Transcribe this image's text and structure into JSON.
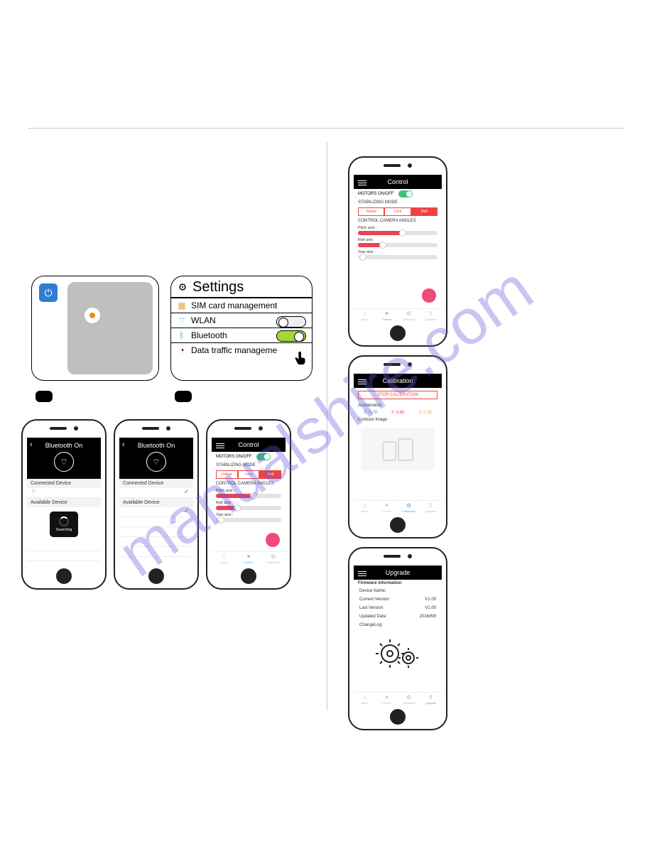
{
  "watermark": "manualshire.com",
  "settings_panel": {
    "title": "Settings",
    "rows": {
      "sim": "SIM card management",
      "wlan": "WLAN",
      "bluetooth": "Bluetooth",
      "data": "Data traffic manageme"
    }
  },
  "bt_search": {
    "header": "Bluetooth On",
    "connected_label": "Connected Device",
    "available_label": "Available Device",
    "searching": "Searching"
  },
  "bt_found": {
    "header": "Bluetooth On",
    "connected_label": "Connected Device",
    "available_label": "Available Device"
  },
  "control": {
    "header": "Control",
    "motors": "MOTORS ON/OFF",
    "stab_mode": "STABILIZING MODE",
    "modes": {
      "follow": "Follow",
      "lock": "Lock",
      "roll": "Roll"
    },
    "cam_angles": "CONTROL CAMERA ANGLES",
    "pitch": "Pitch axis :",
    "roll_axis": "Roll axis :",
    "yaw": "Yaw axis :",
    "tabs": {
      "about": "About",
      "control": "Control",
      "calib": "Calibration",
      "upgrade": "Upgrade"
    }
  },
  "calibration": {
    "header": "Calibration",
    "stop_btn": "STOP CALIBRATION",
    "accel_label": "Acceleration",
    "accel": {
      "x_label": "X:",
      "x": "0.78",
      "y_label": "Y:",
      "y": "0.60",
      "z_label": "Z:",
      "z": "0.30"
    },
    "contrast": "Contrast Image"
  },
  "upgrade": {
    "header": "Upgrade",
    "section": "Firmware Information",
    "device_name_label": "Device Name:",
    "current_label": "Current Version:",
    "current": "V1.00",
    "last_label": "Last Version:",
    "last": "V1.00",
    "updated_label": "Updated Date:",
    "updated": "2016/6/8",
    "changelog_label": "ChangeLog:"
  }
}
